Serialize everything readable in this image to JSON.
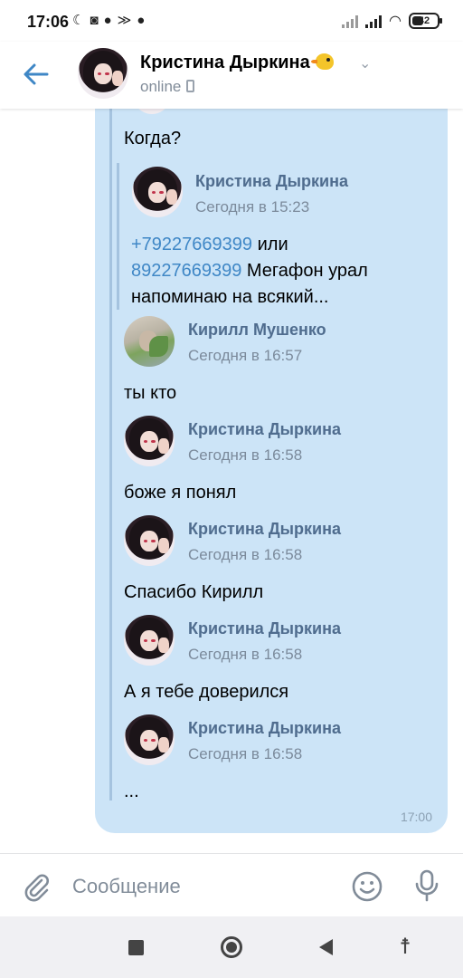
{
  "status_bar": {
    "time": "17:06",
    "battery": "42"
  },
  "header": {
    "name": "Кристина Дыркина",
    "status": "online",
    "emoji_icon": "chick-icon"
  },
  "messages": [
    {
      "type": "text",
      "text": "Когда?"
    },
    {
      "type": "author",
      "name": "Кристина Дыркина",
      "time": "Сегодня в 15:23",
      "avatar": "kristina"
    },
    {
      "type": "rich",
      "phone1": "+79227669399",
      "mid": " или",
      "phone2": "89227669399",
      "tail": " Мегафон урал",
      "line3": "напоминаю на всякий..."
    },
    {
      "type": "author",
      "name": "Кирилл Мушенко",
      "time": "Сегодня в 16:57",
      "avatar": "kirill"
    },
    {
      "type": "text",
      "text": "ты кто"
    },
    {
      "type": "author",
      "name": "Кристина Дыркина",
      "time": "Сегодня в 16:58",
      "avatar": "kristina"
    },
    {
      "type": "text",
      "text": "боже я понял"
    },
    {
      "type": "author",
      "name": "Кристина Дыркина",
      "time": "Сегодня в 16:58",
      "avatar": "kristina"
    },
    {
      "type": "text",
      "text": "Спасибо Кирилл"
    },
    {
      "type": "author",
      "name": "Кристина Дыркина",
      "time": "Сегодня в 16:58",
      "avatar": "kristina"
    },
    {
      "type": "text",
      "text": "А я тебе доверился"
    },
    {
      "type": "author",
      "name": "Кристина Дыркина",
      "time": "Сегодня в 16:58",
      "avatar": "kristina"
    },
    {
      "type": "text",
      "text": "..."
    }
  ],
  "bubble_time": "17:00",
  "composer": {
    "placeholder": "Сообщение"
  },
  "colors": {
    "bubble": "#cce4f7",
    "accent": "#3f87c6",
    "sender": "#4f6c8e"
  }
}
